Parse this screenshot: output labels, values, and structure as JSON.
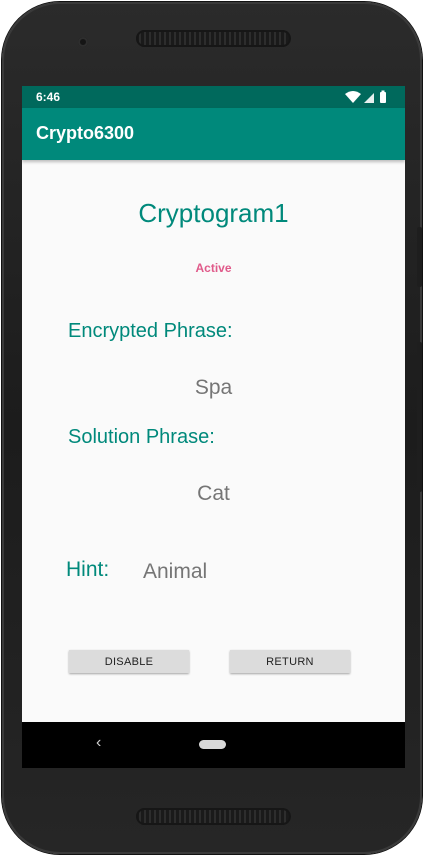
{
  "status_bar": {
    "time": "6:46",
    "icons": [
      "wifi-icon",
      "signal-icon",
      "battery-icon"
    ]
  },
  "app_bar": {
    "title": "Crypto6300"
  },
  "cryptogram": {
    "title": "Cryptogram1",
    "state": "Active",
    "encrypted_label": "Encrypted Phrase:",
    "encrypted_value": "Spa",
    "solution_label": "Solution Phrase:",
    "solution_value": "Cat",
    "hint_label": "Hint:",
    "hint_value": "Animal"
  },
  "buttons": {
    "disable": "DISABLE",
    "return": "RETURN"
  },
  "nav": {
    "back_glyph": "‹"
  },
  "colors": {
    "accent": "#00897b",
    "status_bar": "#00695c",
    "state_text": "#e05a8a"
  }
}
